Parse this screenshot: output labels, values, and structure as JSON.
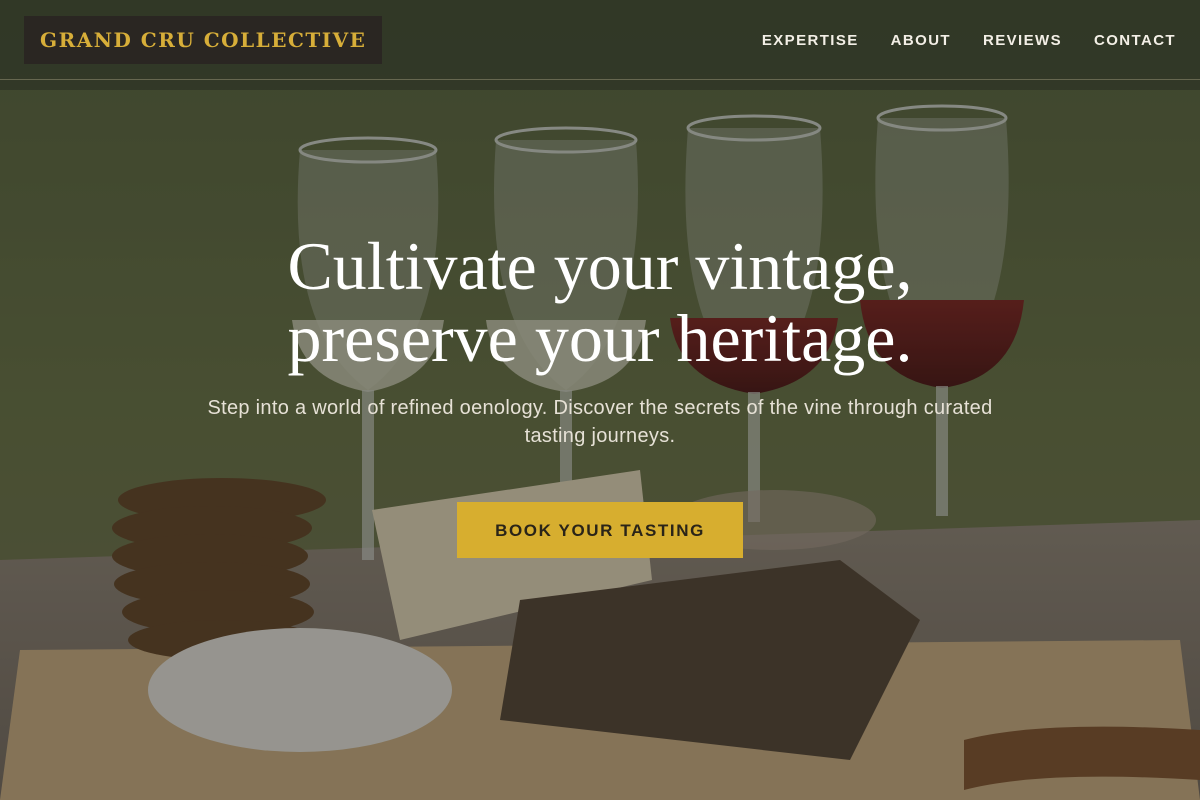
{
  "header": {
    "brand": "GRAND CRU COLLECTIVE",
    "nav": [
      {
        "label": "EXPERTISE"
      },
      {
        "label": "ABOUT"
      },
      {
        "label": "REVIEWS"
      },
      {
        "label": "CONTACT"
      }
    ]
  },
  "hero": {
    "title_line1": "Cultivate your vintage,",
    "title_line2": "preserve your heritage.",
    "subtitle": "Step into a world of refined oenology. Discover the secrets of the vine through curated tasting journeys.",
    "cta_label": "BOOK YOUR TASTING"
  },
  "colors": {
    "accent": "#d7ae2f",
    "brand_text": "#d7ae39",
    "brand_bg": "#2a2622",
    "nav_text": "#f3efe6"
  }
}
